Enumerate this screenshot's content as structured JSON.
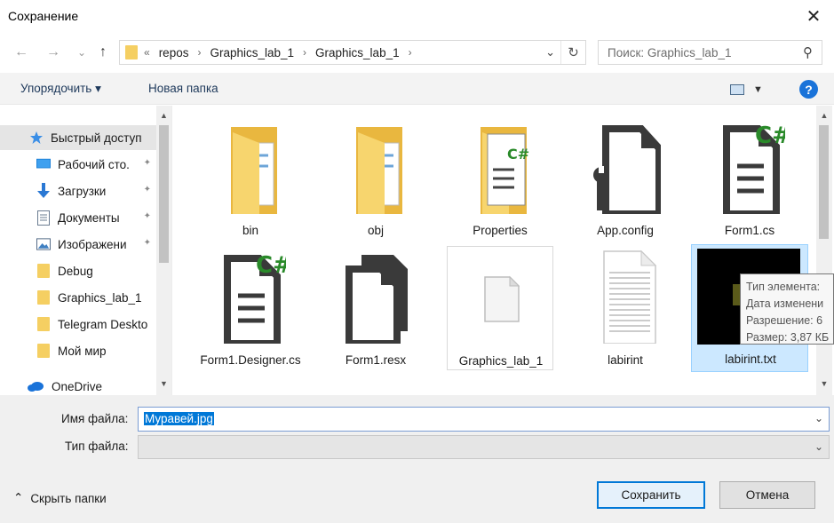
{
  "window": {
    "title": "Сохранение",
    "close_glyph": "✕"
  },
  "nav": {
    "back_glyph": "←",
    "forward_glyph": "→",
    "history_glyph": "⌄",
    "up_glyph": "↑",
    "crumb_lead": "«",
    "crumbs": [
      "repos",
      "Graphics_lab_1",
      "Graphics_lab_1"
    ],
    "crumb_sep": "›",
    "dropdown_glyph": "⌄",
    "refresh_glyph": "↻",
    "search_placeholder": "Поиск: Graphics_lab_1",
    "search_icon": "search-icon",
    "search_glyph": "⚲"
  },
  "toolbar": {
    "organize": "Упорядочить ▾",
    "new_folder": "Новая папка",
    "view_arrow": "▼",
    "help": "?"
  },
  "sidebar": {
    "items": [
      {
        "label": "Быстрый доступ",
        "icon": "star-icon",
        "pinned": false
      },
      {
        "label": "Рабочий сто.",
        "icon": "desktop-icon",
        "pinned": true
      },
      {
        "label": "Загрузки",
        "icon": "download-icon",
        "pinned": true
      },
      {
        "label": "Документы",
        "icon": "document-icon",
        "pinned": true
      },
      {
        "label": "Изображени",
        "icon": "pictures-icon",
        "pinned": true
      },
      {
        "label": "Debug",
        "icon": "folder-icon",
        "pinned": false
      },
      {
        "label": "Graphics_lab_1",
        "icon": "folder-icon",
        "pinned": false
      },
      {
        "label": "Telegram Deskto",
        "icon": "folder-icon",
        "pinned": false
      },
      {
        "label": "Мой мир",
        "icon": "folder-icon",
        "pinned": false
      },
      {
        "label": "OneDrive",
        "icon": "cloud-icon",
        "pinned": false
      }
    ],
    "pin_glyph": "📌",
    "scroll_up_glyph": "▲",
    "scroll_down_glyph": "▼"
  },
  "files": {
    "items": [
      {
        "label": "bin",
        "icon": "folder-icon"
      },
      {
        "label": "obj",
        "icon": "folder-icon"
      },
      {
        "label": "Properties",
        "icon": "folder-csharp-icon"
      },
      {
        "label": "App.config",
        "icon": "config-file-icon"
      },
      {
        "label": "Form1.cs",
        "icon": "csharp-file-icon"
      },
      {
        "label": "Form1.Designer.cs",
        "icon": "csharp-file-icon"
      },
      {
        "label": "Form1.resx",
        "icon": "resx-file-icon"
      },
      {
        "label": "Graphics_lab_1",
        "icon": "blank-file-icon"
      },
      {
        "label": "labirint",
        "icon": "text-file-icon"
      },
      {
        "label": "labirint.txt",
        "icon": "image-thumbnail-icon"
      }
    ],
    "csharp_badge": "C#",
    "scroll_up_glyph": "▲",
    "scroll_down_glyph": "▼"
  },
  "tooltip": {
    "lines": [
      "Тип элемента:",
      "Дата изменени",
      "Разрешение: 6",
      "Размер: 3,87 КБ"
    ]
  },
  "form": {
    "filename_label": "Имя файла:",
    "filename_value": "Муравей.jpg",
    "filetype_label": "Тип файла:",
    "filetype_value": "",
    "dropdown_glyph": "⌄",
    "hide_folders": "Скрыть папки",
    "hide_glyph": "⌃",
    "save": "Сохранить",
    "cancel": "Отмена"
  },
  "colors": {
    "accent": "#0078d7",
    "folder": "#f5cf62",
    "csharp": "#2a8a2a",
    "selection": "#cce8ff"
  }
}
